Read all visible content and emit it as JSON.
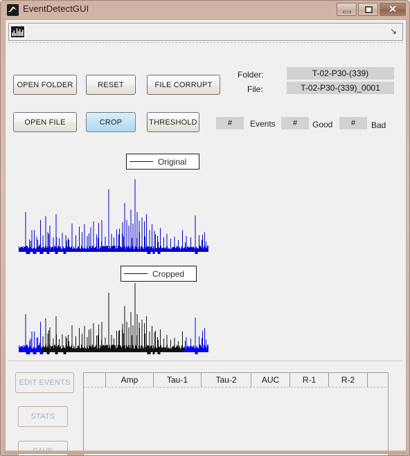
{
  "window": {
    "title": "EventDetectGUI",
    "icon": "matlab-logo-icon",
    "controls": {
      "minimize": "minimize-icon",
      "maximize": "maximize-icon",
      "close": "✕"
    }
  },
  "toolbar": {
    "icon_label": "histogram-icon",
    "overflow_glyph": "↘"
  },
  "buttons": {
    "open_folder": "OPEN FOLDER",
    "reset": "RESET",
    "file_corrupt": "FILE CORRUPT",
    "open_file": "OPEN FILE",
    "crop": "CROP",
    "threshold": "THRESHOLD",
    "edit_events": "EDIT EVENTS",
    "stats": "STATS",
    "save": "SAVE"
  },
  "info": {
    "folder_label": "Folder:",
    "folder_value": "T-02-P30-(339)",
    "file_label": "File:",
    "file_value": "T-02-P30-(339)_0001"
  },
  "counters": [
    {
      "value": "#",
      "label": "Events"
    },
    {
      "value": "#",
      "label": "Good"
    },
    {
      "value": "#",
      "label": "Bad"
    }
  ],
  "plots": {
    "original": {
      "legend": "Original",
      "color": "#0000d0"
    },
    "cropped": {
      "legend": "Cropped",
      "color": "#111111",
      "outside_color": "#0000ee"
    }
  },
  "table": {
    "columns": [
      "",
      "Amp",
      "Tau-1",
      "Tau-2",
      "AUC",
      "R-1",
      "R-2",
      ""
    ],
    "rows": []
  },
  "chart_data": [
    {
      "type": "line",
      "title": "Original",
      "xlabel": "",
      "ylabel": "",
      "legend": [
        "Original"
      ],
      "series_color": "#0000d0",
      "note": "Raw electrophysiology trace: dense noise band with sparse tall positive spikes.",
      "baseline": 0,
      "spikes": [
        {
          "x": 0.035,
          "h": 0.55
        },
        {
          "x": 0.055,
          "h": 0.17
        },
        {
          "x": 0.068,
          "h": 0.3
        },
        {
          "x": 0.08,
          "h": 0.3
        },
        {
          "x": 0.093,
          "h": 0.21
        },
        {
          "x": 0.113,
          "h": 0.44
        },
        {
          "x": 0.125,
          "h": 0.23
        },
        {
          "x": 0.14,
          "h": 0.49
        },
        {
          "x": 0.152,
          "h": 0.27
        },
        {
          "x": 0.163,
          "h": 0.36
        },
        {
          "x": 0.18,
          "h": 0.2
        },
        {
          "x": 0.196,
          "h": 0.52
        },
        {
          "x": 0.212,
          "h": 0.19
        },
        {
          "x": 0.228,
          "h": 0.26
        },
        {
          "x": 0.247,
          "h": 0.23
        },
        {
          "x": 0.263,
          "h": 0.16
        },
        {
          "x": 0.28,
          "h": 0.39
        },
        {
          "x": 0.3,
          "h": 0.23
        },
        {
          "x": 0.318,
          "h": 0.35
        },
        {
          "x": 0.333,
          "h": 0.27
        },
        {
          "x": 0.345,
          "h": 0.38
        },
        {
          "x": 0.36,
          "h": 0.22
        },
        {
          "x": 0.378,
          "h": 0.34
        },
        {
          "x": 0.393,
          "h": 0.42
        },
        {
          "x": 0.408,
          "h": 0.24
        },
        {
          "x": 0.42,
          "h": 0.4
        },
        {
          "x": 0.437,
          "h": 0.44
        },
        {
          "x": 0.455,
          "h": 0.21
        },
        {
          "x": 0.472,
          "h": 0.86
        },
        {
          "x": 0.487,
          "h": 0.25
        },
        {
          "x": 0.5,
          "h": 0.2
        },
        {
          "x": 0.515,
          "h": 0.31
        },
        {
          "x": 0.53,
          "h": 0.32
        },
        {
          "x": 0.545,
          "h": 0.41
        },
        {
          "x": 0.556,
          "h": 0.67
        },
        {
          "x": 0.567,
          "h": 0.44
        },
        {
          "x": 0.578,
          "h": 0.36
        },
        {
          "x": 0.59,
          "h": 0.58
        },
        {
          "x": 0.6,
          "h": 0.39
        },
        {
          "x": 0.612,
          "h": 1.0
        },
        {
          "x": 0.623,
          "h": 0.55
        },
        {
          "x": 0.634,
          "h": 0.43
        },
        {
          "x": 0.648,
          "h": 0.47
        },
        {
          "x": 0.66,
          "h": 0.42
        },
        {
          "x": 0.672,
          "h": 0.52
        },
        {
          "x": 0.688,
          "h": 0.3
        },
        {
          "x": 0.7,
          "h": 0.38
        },
        {
          "x": 0.714,
          "h": 0.29
        },
        {
          "x": 0.73,
          "h": 0.22
        },
        {
          "x": 0.745,
          "h": 0.33
        },
        {
          "x": 0.762,
          "h": 0.2
        },
        {
          "x": 0.78,
          "h": 0.25
        },
        {
          "x": 0.8,
          "h": 0.18
        },
        {
          "x": 0.82,
          "h": 0.21
        },
        {
          "x": 0.84,
          "h": 0.16
        },
        {
          "x": 0.862,
          "h": 0.3
        },
        {
          "x": 0.882,
          "h": 0.22
        },
        {
          "x": 0.905,
          "h": 0.2
        },
        {
          "x": 0.928,
          "h": 0.5
        },
        {
          "x": 0.948,
          "h": 0.23
        },
        {
          "x": 0.965,
          "h": 0.17
        }
      ]
    },
    {
      "type": "line",
      "title": "Cropped",
      "xlabel": "",
      "ylabel": "",
      "legend": [
        "Cropped"
      ],
      "series_color": "#111111",
      "note": "Same trace with crop selection: region inside crop drawn black, regions outside crop drawn blue.",
      "crop_start_fraction": 0.115,
      "crop_end_fraction": 0.865
    }
  ]
}
